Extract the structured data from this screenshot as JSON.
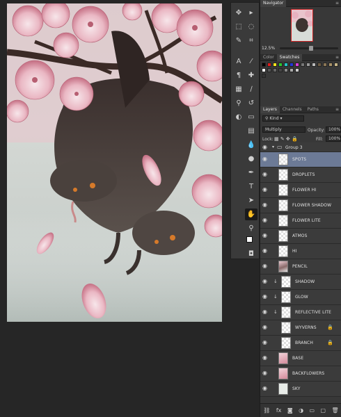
{
  "navigator": {
    "tab": "Navigator",
    "zoom": "12.5%"
  },
  "color_panel": {
    "tabs": [
      "Color",
      "Swatches"
    ],
    "active": "Swatches"
  },
  "layers_panel": {
    "tabs": [
      "Layers",
      "Channels",
      "Paths"
    ],
    "kind_filter": "Kind",
    "blend_mode": "Multiply",
    "opacity_label": "Opacity:",
    "opacity_value": "100%",
    "lock_label": "Lock:",
    "fill_label": "Fill:",
    "fill_value": "100%",
    "layers": [
      {
        "name": "Group 3",
        "type": "group"
      },
      {
        "name": "SPOTS",
        "selected": true
      },
      {
        "name": "DROPLETS"
      },
      {
        "name": "FLOWER HI"
      },
      {
        "name": "FLOWER SHADOW"
      },
      {
        "name": "FLOWER LITE"
      },
      {
        "name": "ATMOS"
      },
      {
        "name": "HI"
      },
      {
        "name": "PENCIL"
      },
      {
        "name": "SHADOW"
      },
      {
        "name": "GLOW"
      },
      {
        "name": "REFLECTIVE LITE"
      },
      {
        "name": "WYVERNS"
      },
      {
        "name": "BRANCH"
      },
      {
        "name": "BASE"
      },
      {
        "name": "BACKFLOWERS"
      },
      {
        "name": "SKY"
      }
    ]
  },
  "colors": {
    "foreground": "#ffffff",
    "background": "#e03a20",
    "accent_selection": "#6c7a96"
  },
  "icons": [
    "move-tool-icon",
    "marquee-tool-icon",
    "lasso-tool-icon",
    "quick-select-icon",
    "crop-tool-icon",
    "eyedropper-icon",
    "healing-brush-icon",
    "brush-tool-icon",
    "clone-stamp-icon",
    "history-brush-icon",
    "eraser-tool-icon",
    "gradient-tool-icon",
    "blur-tool-icon",
    "dodge-tool-icon",
    "pen-tool-icon",
    "type-tool-icon",
    "path-select-icon",
    "shape-tool-icon",
    "hand-tool-icon",
    "zoom-tool-icon"
  ]
}
